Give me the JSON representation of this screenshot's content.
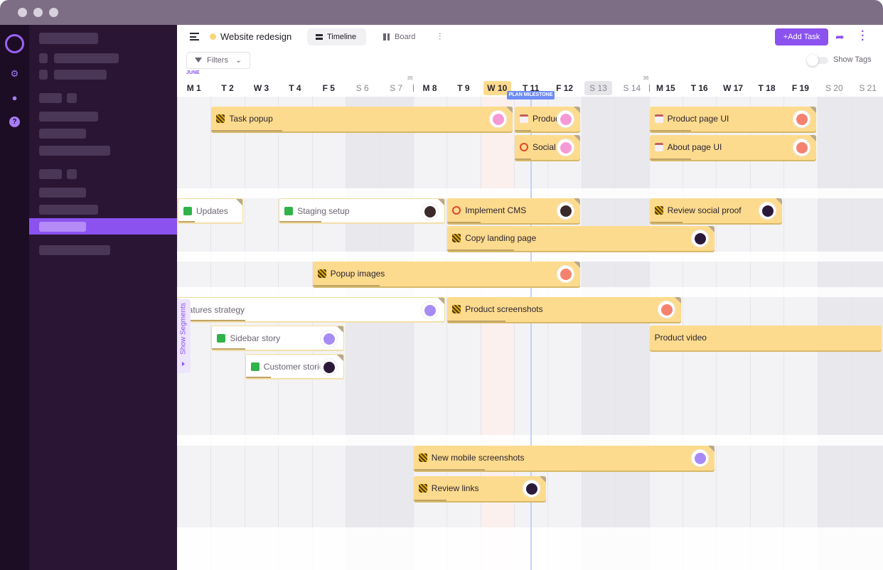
{
  "window": {
    "title": ""
  },
  "header": {
    "project_title": "Website redesign",
    "project_dot_color": "#f9d57a",
    "tabs": [
      {
        "label": "Timeline",
        "icon": "timeline-icon",
        "selected": true
      },
      {
        "label": "Board",
        "icon": "board-icon",
        "selected": false
      }
    ],
    "add_task_label": "+Add Task",
    "filters_label": "Filters",
    "show_tags_label": "Show Tags",
    "show_tags_on": false
  },
  "timeline": {
    "month": "JUNE",
    "week_markers": [
      {
        "label": "35",
        "before_day": 8
      },
      {
        "label": "36",
        "before_day": 15
      }
    ],
    "today": 10,
    "milestone_label": "PLAN MILESTONE",
    "milestone_day": 11,
    "days": [
      {
        "d": 1,
        "label": "M 1"
      },
      {
        "d": 2,
        "label": "T 2"
      },
      {
        "d": 3,
        "label": "W 3"
      },
      {
        "d": 4,
        "label": "T 4"
      },
      {
        "d": 5,
        "label": "F 5"
      },
      {
        "d": 6,
        "label": "S 6",
        "weekend": true
      },
      {
        "d": 7,
        "label": "S 7",
        "weekend": true
      },
      {
        "d": 8,
        "label": "M 8"
      },
      {
        "d": 9,
        "label": "T 9"
      },
      {
        "d": 10,
        "label": "W 10"
      },
      {
        "d": 11,
        "label": "T 11"
      },
      {
        "d": 12,
        "label": "F 12"
      },
      {
        "d": 13,
        "label": "S 13",
        "weekend": true
      },
      {
        "d": 14,
        "label": "S 14",
        "weekend": true
      },
      {
        "d": 15,
        "label": "M 15"
      },
      {
        "d": 16,
        "label": "T 16"
      },
      {
        "d": 17,
        "label": "W 17"
      },
      {
        "d": 18,
        "label": "T 18"
      },
      {
        "d": 19,
        "label": "F 19"
      },
      {
        "d": 20,
        "label": "S 20",
        "weekend": true
      },
      {
        "d": 21,
        "label": "S 21",
        "weekend": true
      }
    ],
    "show_segments_label": "Show Segments",
    "tasks": [
      {
        "title": "Task popup",
        "status": "in-progress",
        "start": 2,
        "end": 10,
        "row": 0,
        "avatar": "#f59ad6",
        "done": false
      },
      {
        "title": "Product",
        "status": "draft",
        "start": 11,
        "end": 12,
        "row": 0,
        "avatar": "#f59ad6",
        "done": false
      },
      {
        "title": "Social",
        "status": "blocked",
        "start": 11,
        "end": 12,
        "row": 1,
        "avatar": "#f59ad6",
        "done": false
      },
      {
        "title": "Product page UI",
        "status": "draft",
        "start": 15,
        "end": 19,
        "row": 0,
        "avatar": "#f5826e",
        "done": false
      },
      {
        "title": "About page UI",
        "status": "draft",
        "start": 15,
        "end": 19,
        "row": 1,
        "avatar": "#f5826e",
        "done": false
      },
      {
        "title": "Updates",
        "status": "done",
        "start": 1,
        "end": 2,
        "row": 2,
        "avatar": "",
        "done": true
      },
      {
        "title": "Staging setup",
        "status": "done",
        "start": 4,
        "end": 8,
        "row": 2,
        "avatar": "#3a2a2a",
        "done": true
      },
      {
        "title": "Implement CMS",
        "status": "blocked",
        "start": 9,
        "end": 12,
        "row": 2,
        "avatar": "#3a2a2a",
        "done": false
      },
      {
        "title": "Review social proof",
        "status": "in-progress",
        "start": 15,
        "end": 18,
        "row": 2,
        "avatar": "#2a1a3a",
        "done": false
      },
      {
        "title": "Copy landing page",
        "status": "in-progress",
        "start": 9,
        "end": 16,
        "row": 3,
        "avatar": "#2a1a3a",
        "done": false
      },
      {
        "title": "Popup images",
        "status": "in-progress",
        "start": 5,
        "end": 12,
        "row": 4,
        "avatar": "#f5826e",
        "done": false
      },
      {
        "title": "eatures strategy",
        "status": "none",
        "start": 1,
        "end": 8,
        "row": 5,
        "avatar": "#a78bf5",
        "done": true
      },
      {
        "title": "Product screenshots",
        "status": "in-progress",
        "start": 9,
        "end": 15,
        "row": 5,
        "avatar": "#f5826e",
        "done": false
      },
      {
        "title": "Sidebar story",
        "status": "done",
        "start": 2,
        "end": 5,
        "row": 6,
        "avatar": "#a78bf5",
        "done": true
      },
      {
        "title": "Product video",
        "status": "none",
        "start": 15,
        "end": 22,
        "row": 6,
        "avatar": "",
        "done": false
      },
      {
        "title": "Customer stories",
        "status": "done",
        "start": 3,
        "end": 5,
        "row": 7,
        "avatar": "#2a1a3a",
        "done": true
      },
      {
        "title": "New mobile screenshots",
        "status": "in-progress",
        "start": 8,
        "end": 16,
        "row": 8,
        "avatar": "#a78bf5",
        "done": false
      },
      {
        "title": "Review links",
        "status": "in-progress",
        "start": 8,
        "end": 11,
        "row": 9,
        "avatar": "#2a1a3a",
        "done": false
      }
    ]
  },
  "colors": {
    "accent": "#8b52f0",
    "task_bar": "#fddb8e",
    "milestone": "#6d8cf5"
  }
}
